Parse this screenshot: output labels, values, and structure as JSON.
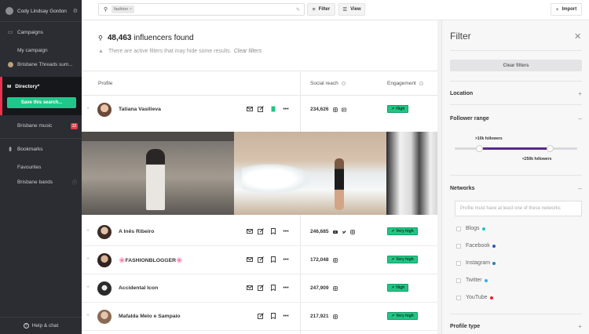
{
  "sidebar": {
    "user_name": "Cody Lindsay Gordon",
    "campaigns_label": "Campaigns",
    "campaign_items": [
      "My campaign",
      "Brisbane Threads sum..."
    ],
    "directory_label": "Directory*",
    "save_search_label": "Save this search...",
    "brisbane_music_label": "Brisbane music",
    "brisbane_music_count": "32",
    "bookmarks_label": "Bookmarks",
    "bookmark_items": [
      "Favourites",
      "Brisbane bands"
    ],
    "help_label": "Help & chat"
  },
  "topbar": {
    "search_chip": "fashion",
    "filter_label": "Filter",
    "view_label": "View",
    "import_label": "Import"
  },
  "main": {
    "results_count": "48,463",
    "results_suffix": "influencers found",
    "warning_text": "There are active filters that may hide some results.",
    "clear_filters_link": "Clear filters",
    "columns": {
      "profile": "Profile",
      "reach": "Social reach",
      "engagement": "Engagement"
    },
    "rows": [
      {
        "name": "Tatiana Vasilieva",
        "reach": "234,626",
        "engagement": "High",
        "networks": [
          "instagram",
          "blog"
        ]
      },
      {
        "name": "A Inês Ribeiro",
        "reach": "246,685",
        "engagement": "Very high",
        "networks": [
          "youtube",
          "twitter",
          "instagram"
        ]
      },
      {
        "name": "🌸FASHIONBLOGGER🌸",
        "reach": "172,048",
        "engagement": "Very high",
        "networks": [
          "instagram"
        ]
      },
      {
        "name": "Accidental Icon",
        "reach": "247,909",
        "engagement": "High",
        "networks": [
          "instagram"
        ]
      },
      {
        "name": "Mafalda Melo e Sampaio",
        "reach": "217,921",
        "engagement": "Very high",
        "networks": [
          "instagram"
        ]
      }
    ]
  },
  "filter": {
    "title": "Filter",
    "clear_button": "Clear filters",
    "location_label": "Location",
    "follower_range_label": "Follower range",
    "range_min_label": ">10k followers",
    "range_max_label": "<250k followers",
    "range_min_fraction": 0.2,
    "range_max_fraction": 0.78,
    "networks_label": "Networks",
    "networks_placeholder": "Profile must have at least one of these networks",
    "networks": [
      {
        "name": "Blogs",
        "color": "#1fc8c0"
      },
      {
        "name": "Facebook",
        "color": "#2f57b5"
      },
      {
        "name": "Instagram",
        "color": "#2e7fa3"
      },
      {
        "name": "Twitter",
        "color": "#3ba9f0"
      },
      {
        "name": "YouTube",
        "color": "#e3262f"
      }
    ],
    "profile_type_label": "Profile type"
  },
  "colors": {
    "sidebar_bg": "#2b2d33",
    "accent_green": "#1fc88a",
    "accent_red": "#e8334a",
    "slider_purple": "#5a2a86"
  }
}
